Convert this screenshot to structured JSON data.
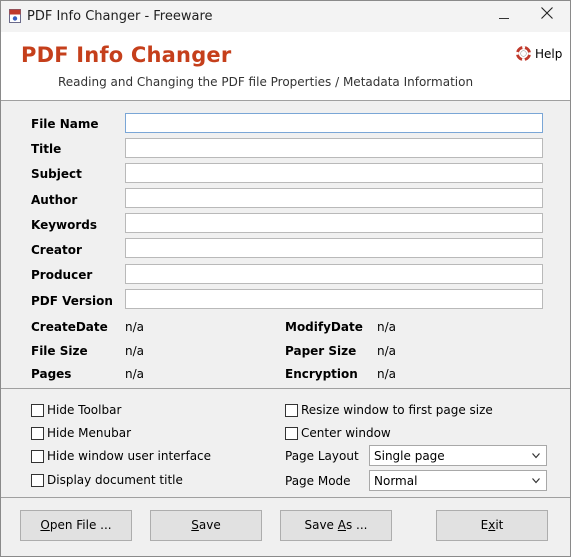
{
  "window": {
    "title": "PDF Info Changer - Freeware"
  },
  "header": {
    "app_title": "PDF Info Changer",
    "subtitle": "Reading and Changing the PDF file Properties / Metadata Information",
    "help_label": "Help"
  },
  "fields": {
    "file_name": {
      "label": "File Name",
      "value": ""
    },
    "title": {
      "label": "Title",
      "value": ""
    },
    "subject": {
      "label": "Subject",
      "value": ""
    },
    "author": {
      "label": "Author",
      "value": ""
    },
    "keywords": {
      "label": "Keywords",
      "value": ""
    },
    "creator": {
      "label": "Creator",
      "value": ""
    },
    "producer": {
      "label": "Producer",
      "value": ""
    },
    "pdf_version": {
      "label": "PDF Version",
      "value": ""
    }
  },
  "info": {
    "create_date": {
      "label": "CreateDate",
      "value": "n/a"
    },
    "modify_date": {
      "label": "ModifyDate",
      "value": "n/a"
    },
    "file_size": {
      "label": "File Size",
      "value": "n/a"
    },
    "paper_size": {
      "label": "Paper Size",
      "value": "n/a"
    },
    "pages": {
      "label": "Pages",
      "value": "n/a"
    },
    "encryption": {
      "label": "Encryption",
      "value": "n/a"
    }
  },
  "options": {
    "hide_toolbar": {
      "label": "Hide Toolbar",
      "checked": false
    },
    "hide_menubar": {
      "label": "Hide Menubar",
      "checked": false
    },
    "hide_window_ui": {
      "label": "Hide window user interface",
      "checked": false
    },
    "display_doc_title": {
      "label": "Display document title",
      "checked": false
    },
    "resize_window": {
      "label": "Resize window to first page size",
      "checked": false
    },
    "center_window": {
      "label": "Center window",
      "checked": false
    },
    "page_layout": {
      "label": "Page Layout",
      "value": "Single page"
    },
    "page_mode": {
      "label": "Page Mode",
      "value": "Normal"
    }
  },
  "buttons": {
    "open_file": {
      "mnemonic": "O",
      "rest": "pen File ..."
    },
    "save": {
      "mnemonic": "S",
      "rest": "ave"
    },
    "save_as": {
      "pre": "Save ",
      "mnemonic": "A",
      "rest": "s ..."
    },
    "exit": {
      "pre": "E",
      "mnemonic": "x",
      "rest": "it"
    }
  },
  "colors": {
    "accent": "#c53f1b",
    "focus_border": "#7aa6d6"
  },
  "icons": {
    "app": "pdf-file-icon",
    "help": "lifebuoy-icon",
    "close": "close-icon",
    "minimize": "minimize-icon",
    "dropdown": "chevron-down-icon"
  }
}
